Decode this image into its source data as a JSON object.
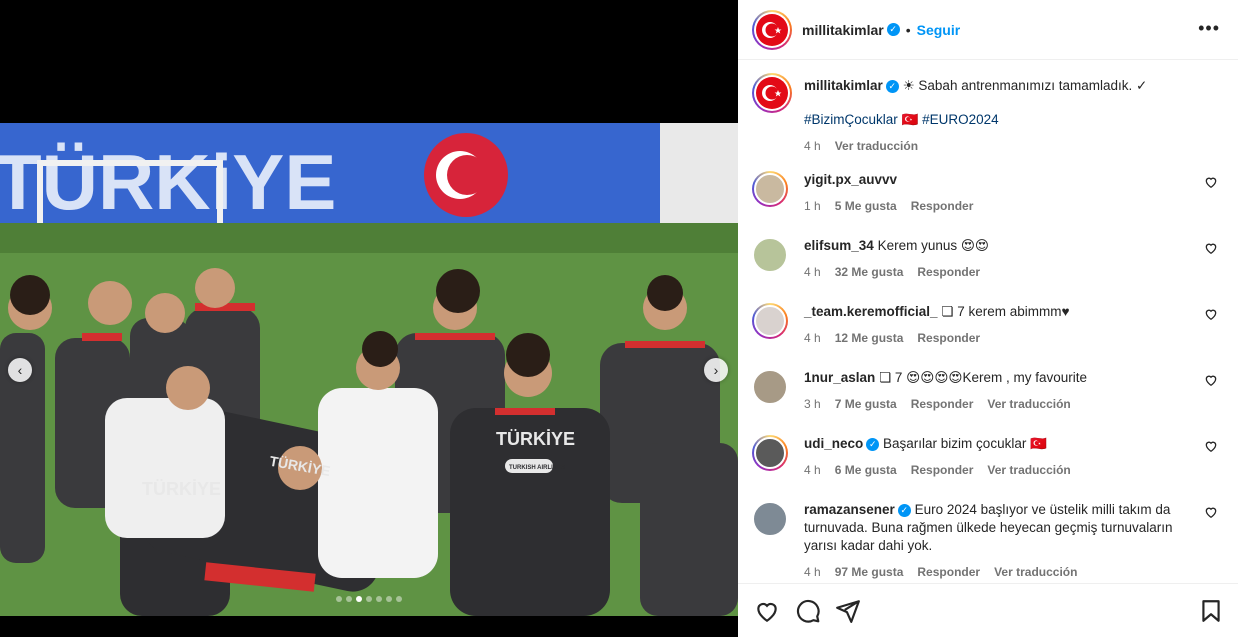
{
  "post": {
    "username": "millitakimlar",
    "follow_label": "Seguir",
    "more_label": "•••",
    "separator": "•"
  },
  "caption": {
    "username": "millitakimlar",
    "text": "☀ Sabah antrenmanımızı tamamladık. ✓",
    "hashtags": "#BizimÇocuklar 🇹🇷 #EURO2024",
    "time": "4 h",
    "translate": "Ver traducción"
  },
  "comments": [
    {
      "username": "yigit.px_auvvv",
      "text": "",
      "time": "1 h",
      "likes": "5 Me gusta",
      "reply": "Responder",
      "translate": ""
    },
    {
      "username": "elifsum_34",
      "text": "Kerem yunus 😍😍",
      "time": "4 h",
      "likes": "32 Me gusta",
      "reply": "Responder",
      "translate": ""
    },
    {
      "username": "_team.keremofficial_",
      "text": "❏ 7 kerem abimmm♥",
      "time": "4 h",
      "likes": "12 Me gusta",
      "reply": "Responder",
      "translate": ""
    },
    {
      "username": "1nur_aslan",
      "text": "❏ 7 😍😍😍😍Kerem , my favourite",
      "time": "3 h",
      "likes": "7 Me gusta",
      "reply": "Responder",
      "translate": "Ver traducción"
    },
    {
      "username": "udi_neco",
      "text": "Başarılar bizim çocuklar 🇹🇷",
      "time": "4 h",
      "likes": "6 Me gusta",
      "reply": "Responder",
      "translate": "Ver traducción",
      "verified": true
    },
    {
      "username": "ramazansener",
      "text": "Euro 2024 başlıyor ve üstelik milli takım da turnuvada. Buna rağmen ülkede heyecan geçmiş turnuvaların yarısı kadar dahi yok.",
      "time": "4 h",
      "likes": "97 Me gusta",
      "reply": "Responder",
      "translate": "Ver traducción",
      "verified": true
    }
  ],
  "media": {
    "banner_text": "TÜRKiYE",
    "shirt_text": "TÜRKİYE",
    "sponsor_text": "TURKISH AIRLINES",
    "carousel_total": 7,
    "carousel_active_index": 2
  },
  "colors": {
    "accent": "#0095f6",
    "flag_red": "#e30a17",
    "hashtag": "#00376b",
    "muted": "#737373"
  },
  "icons": [
    "heart-icon",
    "comment-icon",
    "share-icon",
    "bookmark-icon",
    "more-icon",
    "verified-icon",
    "chevron-left-icon",
    "chevron-right-icon"
  ]
}
